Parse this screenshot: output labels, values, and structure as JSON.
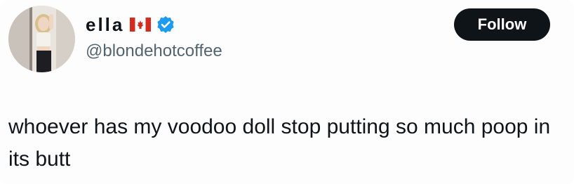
{
  "author": {
    "display_name": "ella",
    "flag_icon": "canada-flag-icon",
    "verified_icon": "verified-badge-icon",
    "handle": "@blondehotcoffee"
  },
  "actions": {
    "follow_label": "Follow"
  },
  "tweet": {
    "text": "whoever has my voodoo doll stop putting so much poop in its butt"
  },
  "colors": {
    "text_primary": "#0f1419",
    "text_secondary": "#536471",
    "verified_blue": "#1d9bf0",
    "follow_bg": "#0f1419",
    "flag_red": "#d52b1e"
  }
}
